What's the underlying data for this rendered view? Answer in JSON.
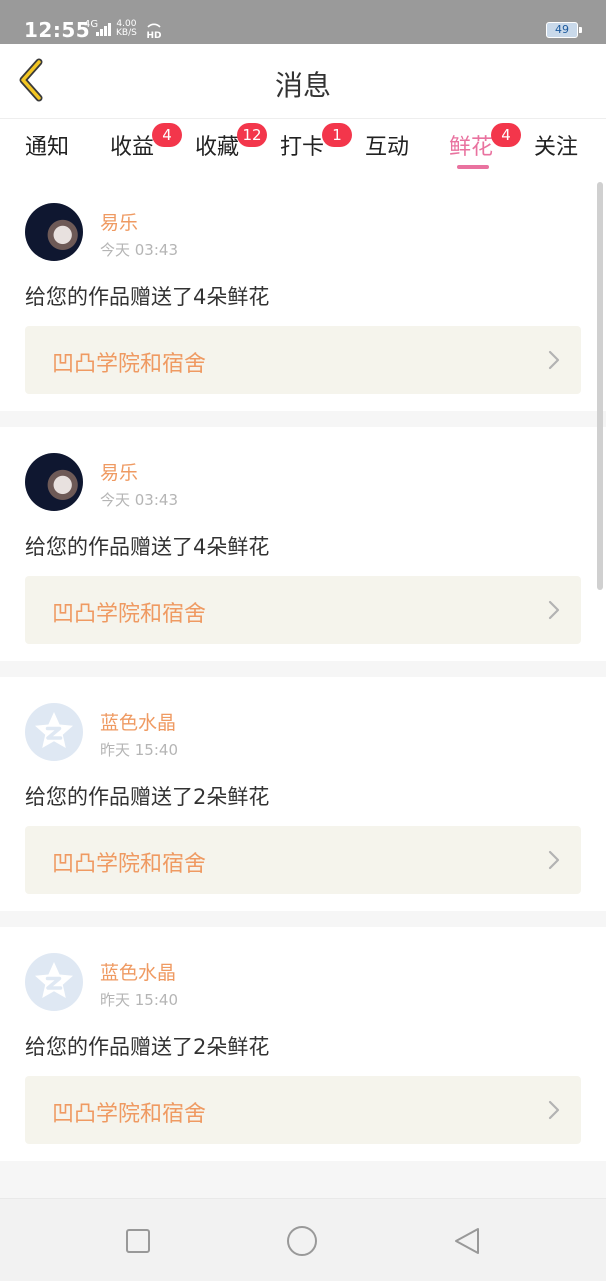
{
  "status_bar": {
    "time": "12:55",
    "signal": "4G",
    "speed_value": "4.00",
    "speed_unit": "KB/S",
    "hd": "HD",
    "battery": "49"
  },
  "header": {
    "title": "消息",
    "back_icon": "back-chevron-icon"
  },
  "tabs": [
    {
      "label": "通知",
      "badge": "",
      "active": false
    },
    {
      "label": "收益",
      "badge": "4",
      "active": false
    },
    {
      "label": "收藏",
      "badge": "12",
      "active": false
    },
    {
      "label": "打卡",
      "badge": "1",
      "active": false
    },
    {
      "label": "互动",
      "badge": "",
      "active": false
    },
    {
      "label": "鲜花",
      "badge": "4",
      "active": true
    },
    {
      "label": "关注",
      "badge": "",
      "active": false
    }
  ],
  "messages": [
    {
      "username": "易乐",
      "time": "今天 03:43",
      "text": "给您的作品赠送了4朵鲜花",
      "work": "凹凸学院和宿舍",
      "avatar": "photo"
    },
    {
      "username": "易乐",
      "time": "今天 03:43",
      "text": "给您的作品赠送了4朵鲜花",
      "work": "凹凸学院和宿舍",
      "avatar": "photo"
    },
    {
      "username": "蓝色水晶",
      "time": "昨天 15:40",
      "text": "给您的作品赠送了2朵鲜花",
      "work": "凹凸学院和宿舍",
      "avatar": "default"
    },
    {
      "username": "蓝色水晶",
      "time": "昨天 15:40",
      "text": "给您的作品赠送了2朵鲜花",
      "work": "凹凸学院和宿舍",
      "avatar": "default"
    }
  ],
  "colors": {
    "accent_pink": "#e9729f",
    "name_orange": "#ef9a62",
    "badge_red": "#f3364b",
    "card_link_bg": "#f5f4ec"
  },
  "nav_bar": [
    "square-icon",
    "circle-icon",
    "triangle-back-icon"
  ]
}
